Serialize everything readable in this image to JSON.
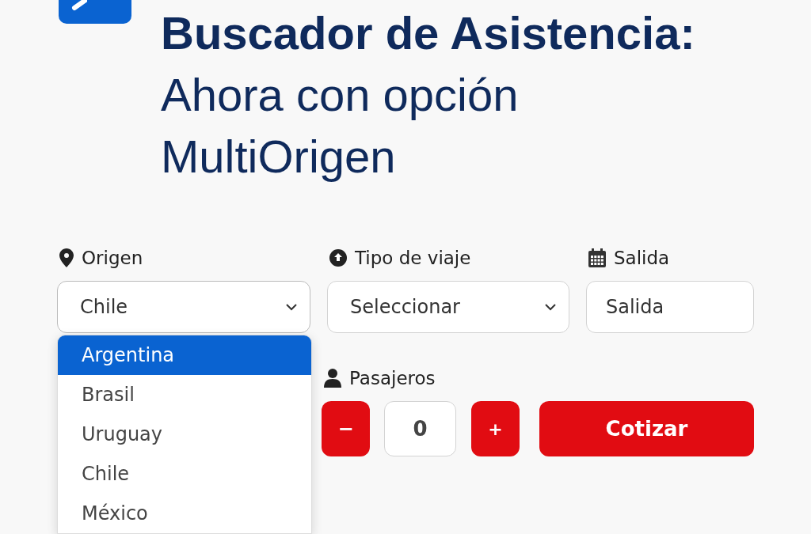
{
  "heading": {
    "strong": "Buscador de Asistencia:",
    "lines": [
      "Ahora con opción",
      "MultiOrigen"
    ]
  },
  "fields": [
    {
      "kind": "select",
      "label": "Origen",
      "value": "Chile",
      "expanded": true
    },
    {
      "kind": "select",
      "label": "Tipo de viaje",
      "value": "Seleccionar",
      "expanded": false
    },
    {
      "kind": "input",
      "label": "Salida",
      "placeholder": "Salida"
    }
  ],
  "origin_options": [
    {
      "label": "Argentina",
      "selected": true
    },
    {
      "label": "Brasil",
      "selected": false
    },
    {
      "label": "Uruguay",
      "selected": false
    },
    {
      "label": "Chile",
      "selected": false
    },
    {
      "label": "México",
      "selected": false
    }
  ],
  "passengers": {
    "label": "Pasajeros",
    "decrement": "−",
    "count": "0",
    "increment": "+"
  },
  "submit": "Cotizar"
}
